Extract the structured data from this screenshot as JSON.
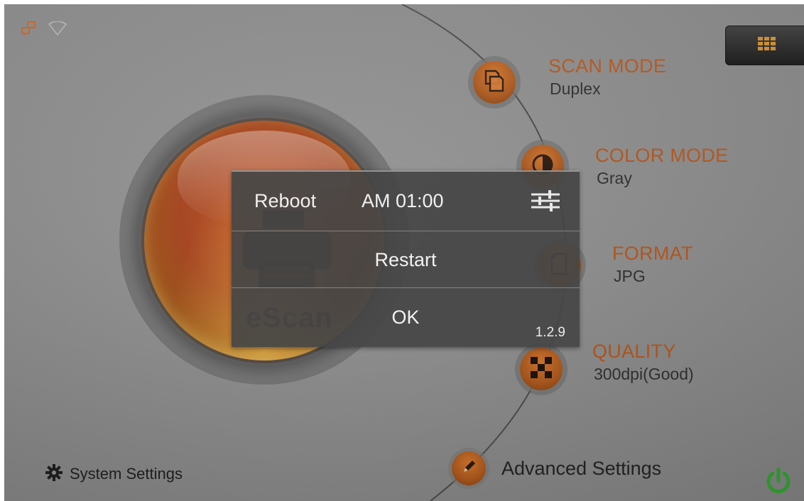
{
  "status_bar": {
    "network_icon": "network-icon",
    "wifi_icon": "wifi-icon"
  },
  "top_right": {
    "icon": "grid-icon"
  },
  "main_button": {
    "label": "eScan",
    "icon": "printer-icon"
  },
  "modes": [
    {
      "title": "SCAN MODE",
      "value": "Duplex",
      "icon": "duplex-pages-icon"
    },
    {
      "title": "COLOR MODE",
      "value": "Gray",
      "icon": "color-circle-icon"
    },
    {
      "title": "FORMAT",
      "value": "JPG",
      "icon": "file-icon"
    },
    {
      "title": "QUALITY",
      "value": "300dpi(Good)",
      "icon": "checker-icon"
    }
  ],
  "footer": {
    "system_settings": "System Settings",
    "advanced_settings": "Advanced Settings",
    "power_icon": "power-icon"
  },
  "dialog": {
    "reboot_label": "Reboot",
    "reboot_time": "AM 01:00",
    "restart": "Restart",
    "ok": "OK",
    "version": "1.2.9"
  },
  "colors": {
    "accent": "#b3541a",
    "power": "#2e9d2e",
    "dialog_bg": "#464646"
  }
}
